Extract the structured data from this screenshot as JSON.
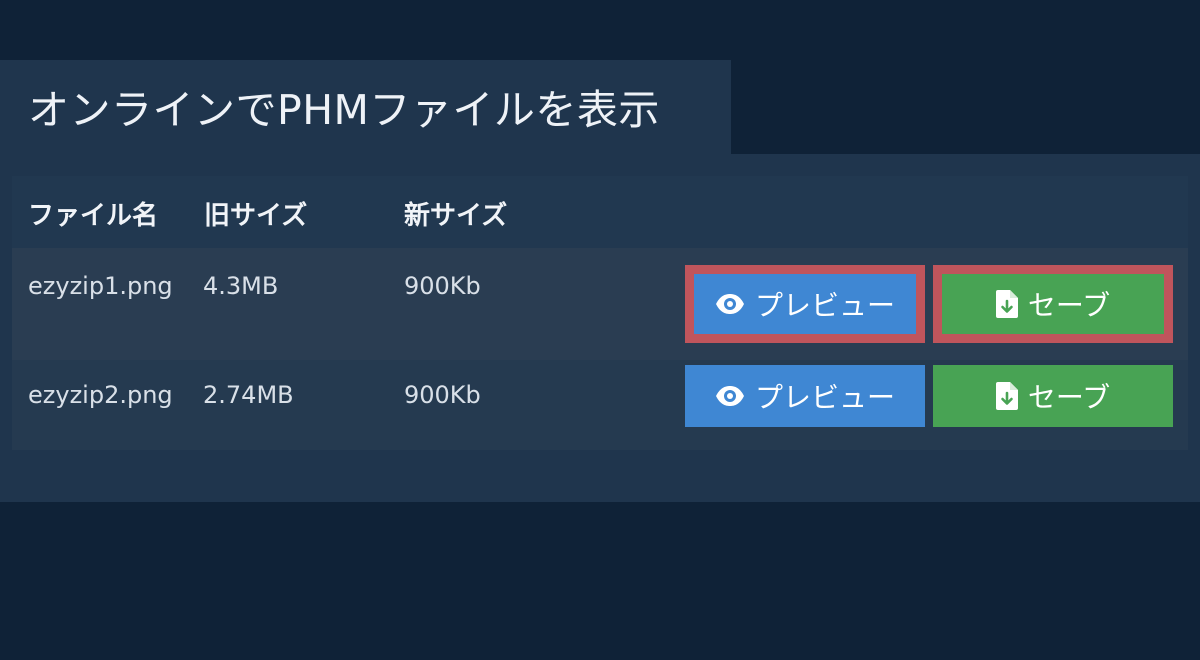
{
  "page": {
    "title": "オンラインでPHMファイルを表示"
  },
  "table": {
    "headers": [
      "ファイル名",
      "旧サイズ",
      "新サイズ"
    ],
    "rows": [
      {
        "filename": "ezyzip1.png",
        "old_size": "4.3MB",
        "new_size": "900Kb",
        "preview_label": "プレビュー",
        "save_label": "セーブ",
        "highlighted": true
      },
      {
        "filename": "ezyzip2.png",
        "old_size": "2.74MB",
        "new_size": "900Kb",
        "preview_label": "プレビュー",
        "save_label": "セーブ",
        "highlighted": false
      }
    ]
  },
  "icons": {
    "preview": "eye-icon",
    "save": "file-download-icon"
  },
  "colors": {
    "background": "#0f2237",
    "panel": "#1f354d",
    "preview_button": "#3f87d3",
    "save_button": "#48a354",
    "highlight_border": "#c0555c"
  }
}
